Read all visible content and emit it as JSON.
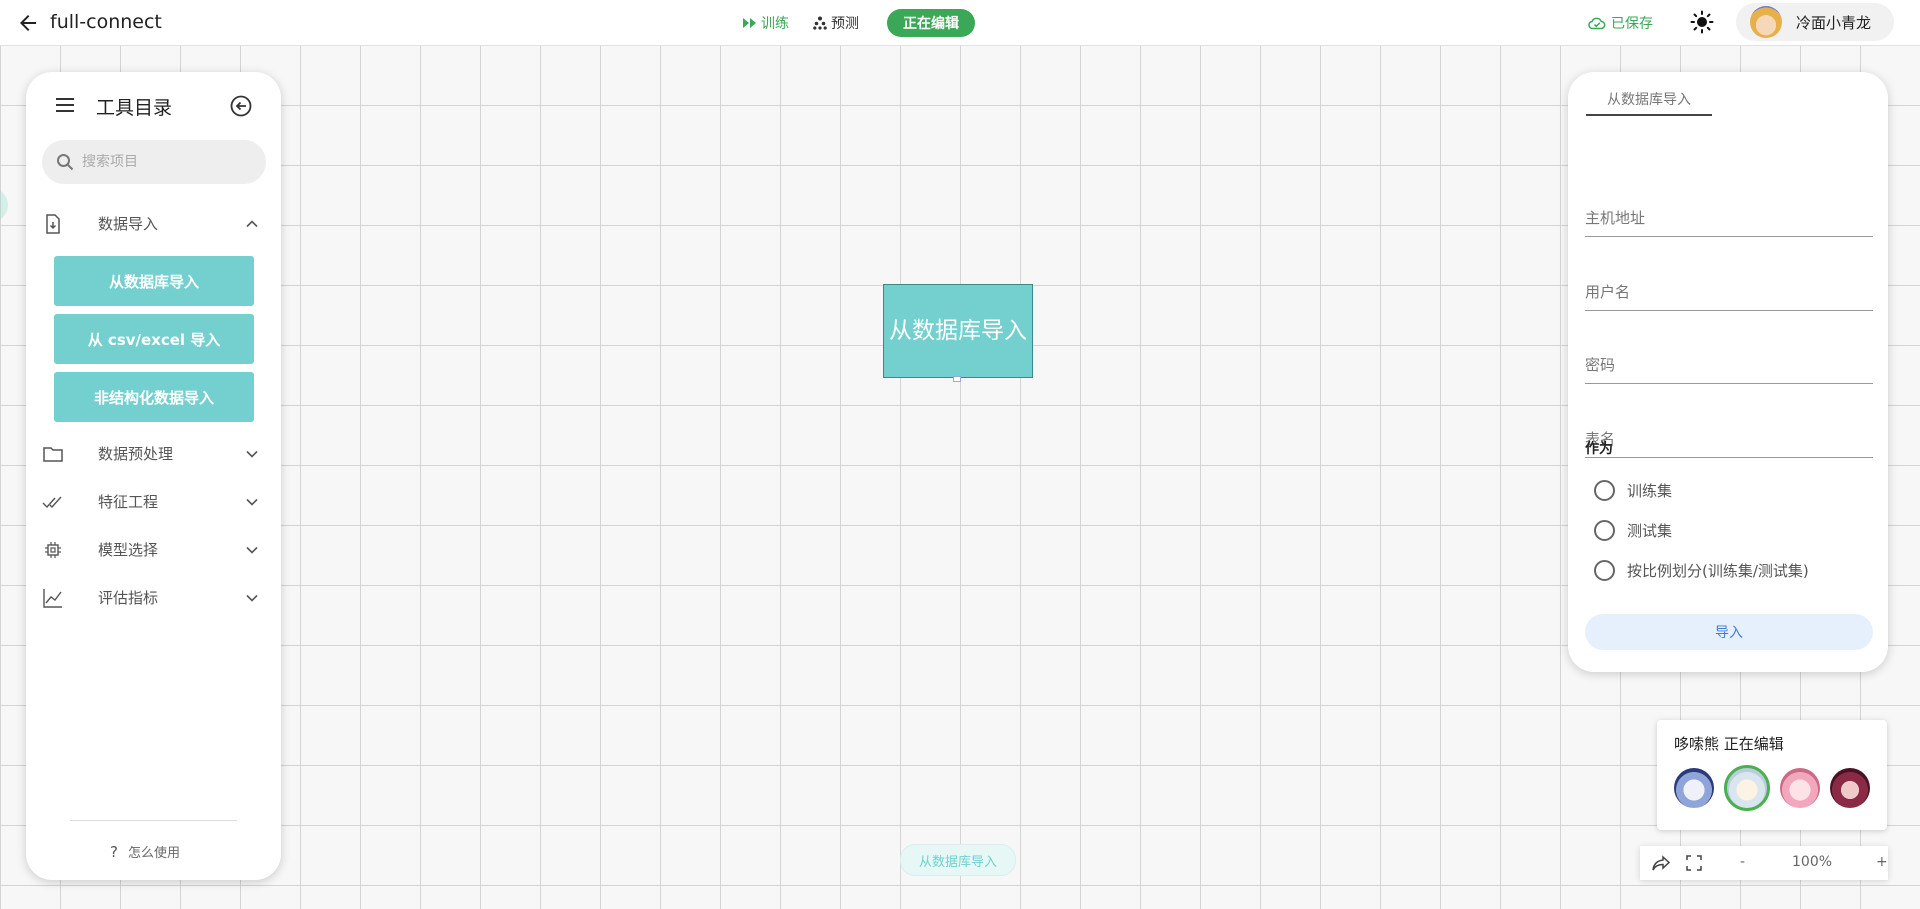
{
  "topbar": {
    "title": "full-connect",
    "train_label": "训练",
    "predict_label": "预测",
    "editing_label": "正在编辑",
    "saved_label": "已保存",
    "user_name": "冷面小青龙"
  },
  "left_panel": {
    "title": "工具目录",
    "search_placeholder": "搜索项目",
    "categories": [
      {
        "label": "数据导入",
        "expanded": true,
        "icon": "file-import-icon"
      },
      {
        "label": "数据预处理",
        "expanded": false,
        "icon": "folder-icon"
      },
      {
        "label": "特征工程",
        "expanded": false,
        "icon": "double-check-icon"
      },
      {
        "label": "模型选择",
        "expanded": false,
        "icon": "chip-icon"
      },
      {
        "label": "评估指标",
        "expanded": false,
        "icon": "line-chart-icon"
      }
    ],
    "tools": [
      "从数据库导入",
      "从 csv/excel 导入",
      "非结构化数据导入"
    ],
    "help_label": "怎么使用"
  },
  "canvas": {
    "node_label": "从数据库导入",
    "bottom_chip": "从数据库导入"
  },
  "right_panel": {
    "tab": "从数据库导入",
    "fields": {
      "host": {
        "placeholder": "主机地址",
        "value": ""
      },
      "username": {
        "placeholder": "用户名",
        "value": ""
      },
      "password": {
        "placeholder": "密码",
        "value": ""
      },
      "table": {
        "placeholder": "表名",
        "value": ""
      }
    },
    "as_label": "作为",
    "options": [
      "训练集",
      "测试集",
      "按比例划分(训练集/测试集)"
    ],
    "import_label": "导入"
  },
  "collaborators": {
    "status_text": "哆嗦熊 正在编辑",
    "count": 4
  },
  "zoom": {
    "level": "100%",
    "minus": "-",
    "plus": "+"
  },
  "colors": {
    "accent_green": "#3aa856",
    "node_teal": "#74cfcf",
    "import_blue": "#3d7fd6"
  }
}
